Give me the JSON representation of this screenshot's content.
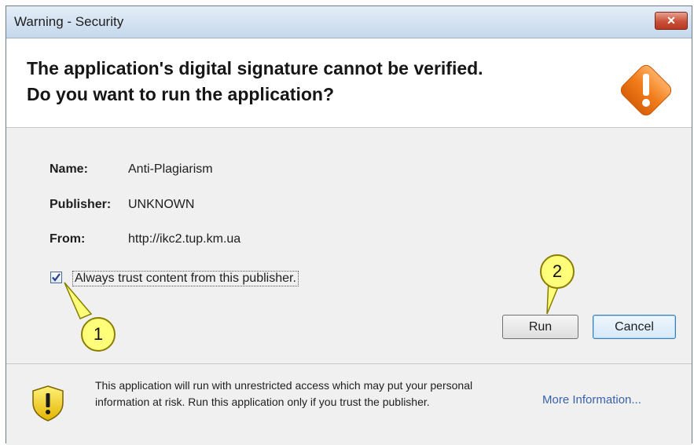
{
  "window": {
    "title": "Warning - Security",
    "close_label": "✕"
  },
  "header": {
    "line1": "The application's digital signature cannot be verified.",
    "line2": "Do you want to run the application?"
  },
  "details": {
    "name_label": "Name:",
    "name_value": "Anti-Plagiarism",
    "publisher_label": "Publisher:",
    "publisher_value": "UNKNOWN",
    "from_label": "From:",
    "from_value": "http://ikc2.tup.km.ua"
  },
  "trust_checkbox": {
    "label": "Always trust content from this publisher.",
    "checked": true
  },
  "buttons": {
    "run": "Run",
    "cancel": "Cancel"
  },
  "callouts": {
    "one": "1",
    "two": "2"
  },
  "footer": {
    "message": "This application will run with unrestricted access which may put your personal information at risk. Run this application only if you trust the publisher.",
    "more_info": "More Information..."
  },
  "colors": {
    "warning_orange": "#f07d1a",
    "callout_yellow": "#fffe7a",
    "link_blue": "#3a62a8"
  }
}
